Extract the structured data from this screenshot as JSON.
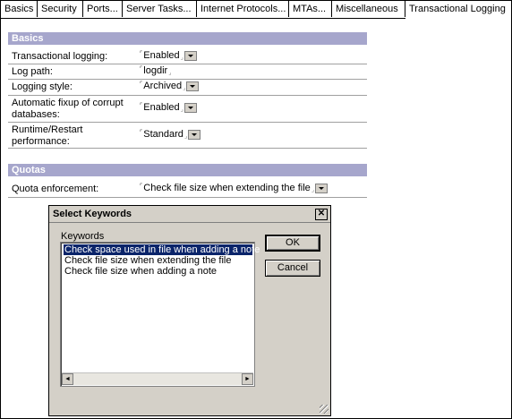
{
  "tabs": [
    "Basics",
    "Security",
    "Ports...",
    "Server Tasks...",
    "Internet Protocols...",
    "MTAs...",
    "Miscellaneous",
    "Transactional Logging"
  ],
  "active_tab": "Transactional Logging",
  "sections": {
    "basics": {
      "title": "Basics",
      "rows": [
        {
          "label": "Transactional logging:",
          "value": "Enabled",
          "has_dropdown": true
        },
        {
          "label": "Log path:",
          "value": "logdir",
          "has_dropdown": false
        },
        {
          "label": "Logging style:",
          "value": "Archived",
          "has_dropdown": true
        },
        {
          "label_line1": "Automatic fixup of corrupt",
          "label_line2": "databases:",
          "value": "Enabled",
          "has_dropdown": true
        },
        {
          "label_line1": "Runtime/Restart",
          "label_line2": "performance:",
          "value": "Standard",
          "has_dropdown": true
        }
      ]
    },
    "quotas": {
      "title": "Quotas",
      "rows": [
        {
          "label": "Quota enforcement:",
          "value": "Check file size when extending the file",
          "has_dropdown": true
        }
      ]
    }
  },
  "dialog": {
    "title": "Select Keywords",
    "close_glyph": "✕",
    "list_label": "Keywords",
    "items": [
      "Check space used in file when adding a note",
      "Check file size when extending the file",
      "Check file size when adding a note"
    ],
    "selected_index": 0,
    "ok_label": "OK",
    "cancel_label": "Cancel",
    "scroll_left_glyph": "◄",
    "scroll_right_glyph": "►"
  },
  "icons": {
    "field_marker": "⌜",
    "field_corner": "⌟"
  }
}
